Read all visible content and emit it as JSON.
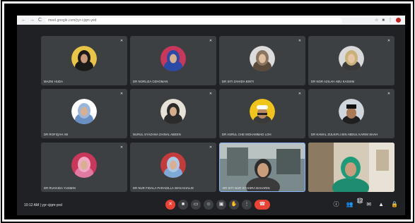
{
  "browser": {
    "nav_back": "←",
    "nav_forward": "→",
    "nav_reload": "C",
    "url": "meet.google.com/yyr-cjqm-yed"
  },
  "participants": [
    {
      "name": "MAZNI HUDA",
      "avatar_bg": "#e8c547",
      "avatar_fg": "#1a1a1a",
      "kind": "hijab-dark"
    },
    {
      "name": "DR NORLIZA OZHOMAN",
      "avatar_bg": "#c9375b",
      "avatar_fg": "#2a4aa8",
      "kind": "hijab-blue"
    },
    {
      "name": "DR SITI ZAHIDA BINTI",
      "avatar_bg": "#dcdcdc",
      "avatar_fg": "#5a4a3a",
      "kind": "hijab-brown"
    },
    {
      "name": "DR NOR AZILAH ABU KASSIM",
      "avatar_bg": "#d9d9d9",
      "avatar_fg": "#c9b27a",
      "kind": "hijab-cream"
    },
    {
      "name": "DR ROFIQAH AB",
      "avatar_bg": "#ffffff",
      "avatar_fg": "#6a8fc2",
      "kind": "hijab-lightblue"
    },
    {
      "name": "NURUL SYAZANA ZAINAL ABIDIN",
      "avatar_bg": "#e6e2d8",
      "avatar_fg": "#2b2b2b",
      "kind": "hijab-black"
    },
    {
      "name": "DR ASRUL CHE MOHAMMAD LOH",
      "avatar_bg": "#f0c419",
      "avatar_fg": "#3a3a3a",
      "kind": "man-cap"
    },
    {
      "name": "DR KAMAL ZULKIFLI BIN ABDUL KARIM SHAH",
      "avatar_bg": "#cfd6dc",
      "avatar_fg": "#1f1f1f",
      "kind": "man-songkok"
    },
    {
      "name": "DR RUHAIDA YUSMIN",
      "avatar_bg": "#c9375b",
      "avatar_fg": "#e07aa0",
      "kind": "hijab-pink"
    },
    {
      "name": "DR NUR FIDALA FARADILLA WAN KHALID",
      "avatar_bg": "#c43b3b",
      "avatar_fg": "#7fa9d6",
      "kind": "hijab-skyblue"
    }
  ],
  "video_participants": [
    {
      "name": "DR SITI NUR SYAHIRA BAHARIN"
    },
    {
      "name": ""
    }
  ],
  "bottom_bar": {
    "time": "10:12 AM",
    "separator": "|",
    "meeting_code": "yyr-cjqm-yed",
    "participant_count": "12"
  },
  "icons": {
    "mic_off": "mic-off-icon",
    "camera": "camera-icon",
    "captions": "captions-icon",
    "emoji": "emoji-icon",
    "present": "present-icon",
    "raise_hand": "raise-hand-icon",
    "more": "more-options-icon",
    "leave": "leave-call-icon"
  },
  "colors": {
    "background": "#202124",
    "tile": "#3c4043",
    "leave": "#ea4335"
  }
}
